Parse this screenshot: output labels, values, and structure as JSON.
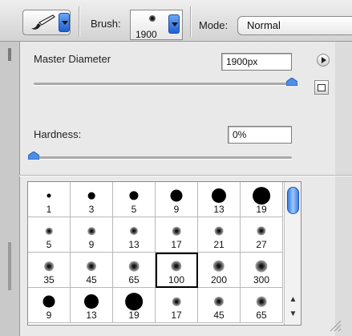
{
  "options_bar": {
    "brush_label": "Brush:",
    "brush_size": "1900",
    "mode_label": "Mode:",
    "mode_value": "Normal"
  },
  "panel": {
    "master_diameter_label": "Master Diameter",
    "master_diameter_value": "1900px",
    "master_diameter_fraction": 1.0,
    "hardness_label": "Hardness:",
    "hardness_value": "0%",
    "hardness_fraction": 0.0
  },
  "presets": [
    {
      "size": "1",
      "kind": "hard"
    },
    {
      "size": "3",
      "kind": "hard"
    },
    {
      "size": "5",
      "kind": "hard"
    },
    {
      "size": "9",
      "kind": "hard"
    },
    {
      "size": "13",
      "kind": "hard"
    },
    {
      "size": "19",
      "kind": "hard"
    },
    {
      "size": "5",
      "kind": "soft"
    },
    {
      "size": "9",
      "kind": "soft"
    },
    {
      "size": "13",
      "kind": "soft"
    },
    {
      "size": "17",
      "kind": "soft"
    },
    {
      "size": "21",
      "kind": "soft"
    },
    {
      "size": "27",
      "kind": "soft"
    },
    {
      "size": "35",
      "kind": "soft"
    },
    {
      "size": "45",
      "kind": "soft"
    },
    {
      "size": "65",
      "kind": "soft"
    },
    {
      "size": "100",
      "kind": "soft",
      "selected": true
    },
    {
      "size": "200",
      "kind": "soft"
    },
    {
      "size": "300",
      "kind": "soft"
    },
    {
      "size": "9",
      "kind": "hard"
    },
    {
      "size": "13",
      "kind": "hard"
    },
    {
      "size": "19",
      "kind": "hard"
    },
    {
      "size": "17",
      "kind": "soft"
    },
    {
      "size": "45",
      "kind": "soft"
    },
    {
      "size": "65",
      "kind": "soft"
    }
  ],
  "icons": {
    "tool": "brush-icon",
    "panel_menu": "flyout-menu-icon",
    "new_preset": "new-preset-icon",
    "resize": "resize-grip-icon"
  },
  "colors": {
    "accent": "#2f6fe0"
  }
}
